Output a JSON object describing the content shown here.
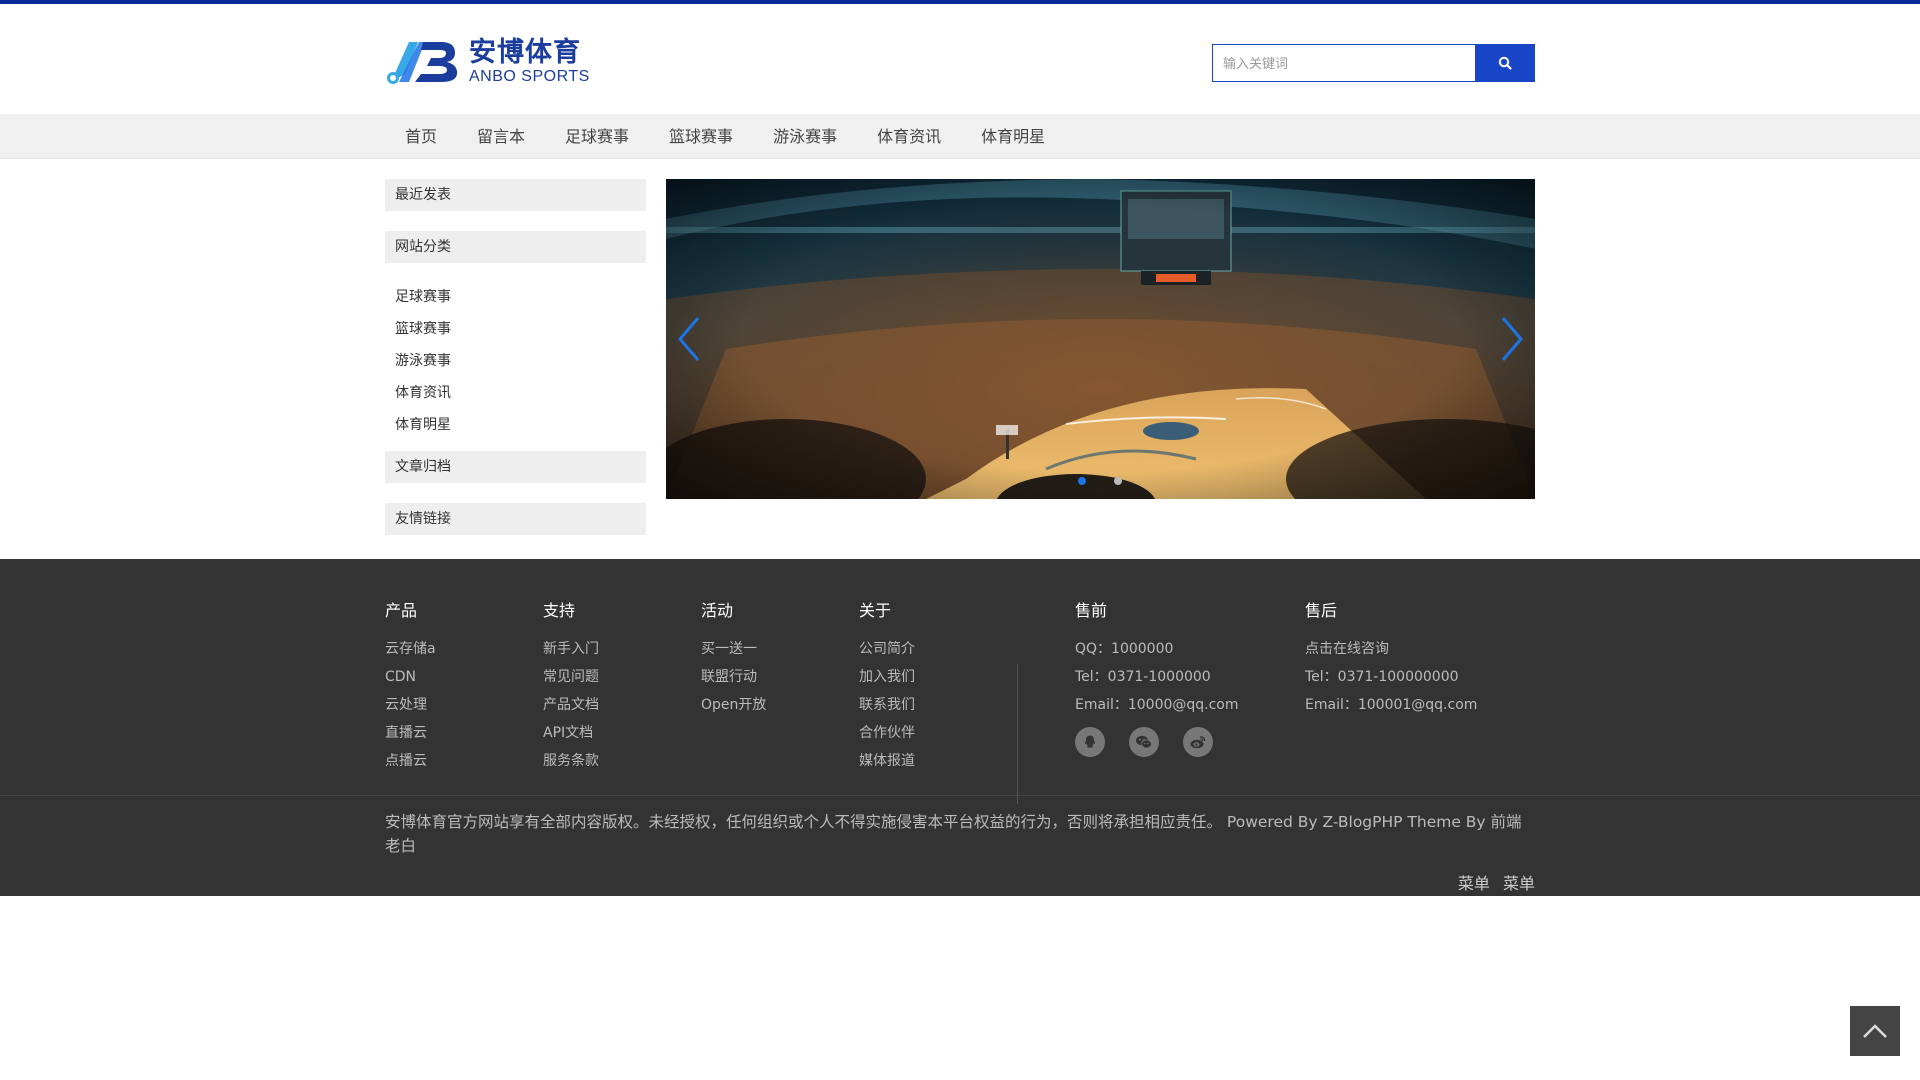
{
  "colors": {
    "brand": "#1846c6",
    "top_line": "#0a2a9c",
    "footer_bg": "#333333",
    "dot_active": "#1e73e6"
  },
  "logo": {
    "cn": "安博体育",
    "en": "ANBO SPORTS",
    "mark_text": "AB"
  },
  "search": {
    "placeholder": "输入关键词",
    "icon": "search-icon"
  },
  "nav": {
    "items": [
      "首页",
      "留言本",
      "足球赛事",
      "篮球赛事",
      "游泳赛事",
      "体育资讯",
      "体育明星"
    ]
  },
  "sidebar": {
    "recent_title": "最近发表",
    "category_title": "网站分类",
    "categories": [
      "足球赛事",
      "篮球赛事",
      "游泳赛事",
      "体育资讯",
      "体育明星"
    ],
    "archive_title": "文章归档",
    "links_title": "友情链接"
  },
  "slider": {
    "slide_count": 2,
    "active": 0,
    "prev_icon": "chevron-left-icon",
    "next_icon": "chevron-right-icon"
  },
  "footer": {
    "columns": [
      {
        "title": "产品",
        "items": [
          "云存储a",
          "CDN",
          "云处理",
          "直播云",
          "点播云"
        ]
      },
      {
        "title": "支持",
        "items": [
          "新手入门",
          "常见问题",
          "产品文档",
          "API文档",
          "服务条款"
        ]
      },
      {
        "title": "活动",
        "items": [
          "买一送一",
          "联盟行动",
          "Open开放"
        ]
      },
      {
        "title": "关于",
        "items": [
          "公司简介",
          "加入我们",
          "联系我们",
          "合作伙伴",
          "媒体报道"
        ]
      }
    ],
    "presale": {
      "title": "售前",
      "qq": "QQ：1000000",
      "tel": "Tel：0371-1000000",
      "email": "Email：10000@qq.com"
    },
    "aftersale": {
      "title": "售后",
      "consult": "点击在线咨询",
      "tel": "Tel：0371-100000000",
      "email": "Email：100001@qq.com"
    },
    "social_icons": [
      "qq-icon",
      "wechat-icon",
      "weibo-icon"
    ],
    "copyright": "安博体育官方网站享有全部内容版权。未经授权，任何组织或个人不得实施侵害本平台权益的行为，否则将承担相应责任。 Powered By Z-BlogPHP Theme By 前端老白",
    "menus": [
      "菜单",
      "菜单"
    ]
  },
  "back_to_top": {
    "icon": "chevron-up-icon"
  }
}
